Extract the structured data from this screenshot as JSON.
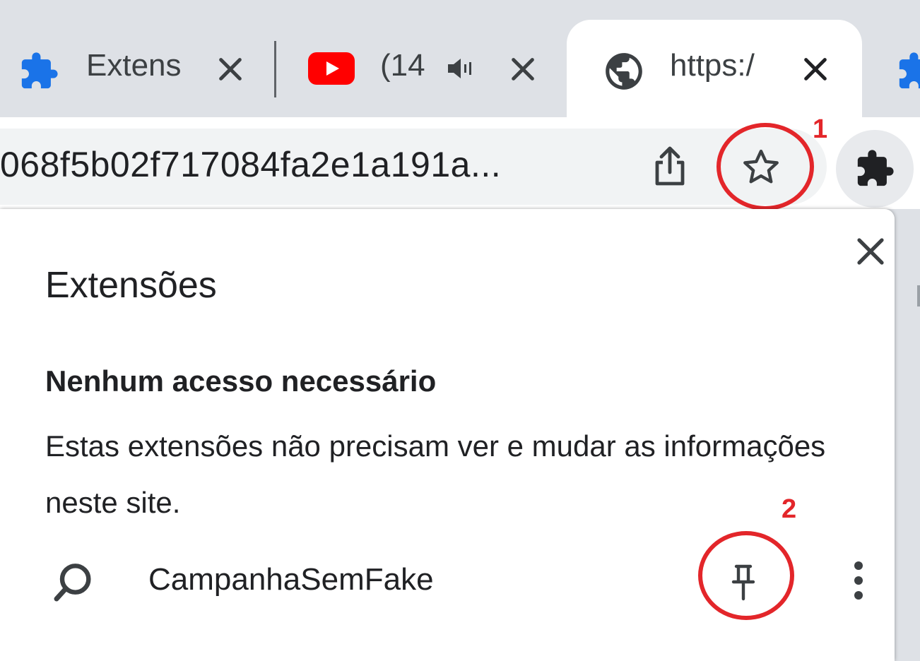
{
  "tabs": [
    {
      "title": "Extens",
      "icon": "puzzle-icon"
    },
    {
      "title": "(14",
      "icon": "youtube-icon",
      "audio": "speaker-icon"
    },
    {
      "title": "https:/",
      "icon": "globe-icon",
      "active": true
    }
  ],
  "omnibox": {
    "url_fragment": "068f5b02f717084fa2e1a191a..."
  },
  "popup": {
    "title": "Extensões",
    "section_heading": "Nenhum acesso necessário",
    "section_description": "Estas extensões não precisam ver e mudar as informações neste site.",
    "extensions": [
      {
        "name": "CampanhaSemFake",
        "icon": "magnifier-icon"
      }
    ]
  },
  "annotations": {
    "one": "1",
    "two": "2"
  },
  "colors": {
    "annotation": "#e3262a",
    "youtube_red": "#ff0000",
    "puzzle_blue": "#1a73e8"
  }
}
